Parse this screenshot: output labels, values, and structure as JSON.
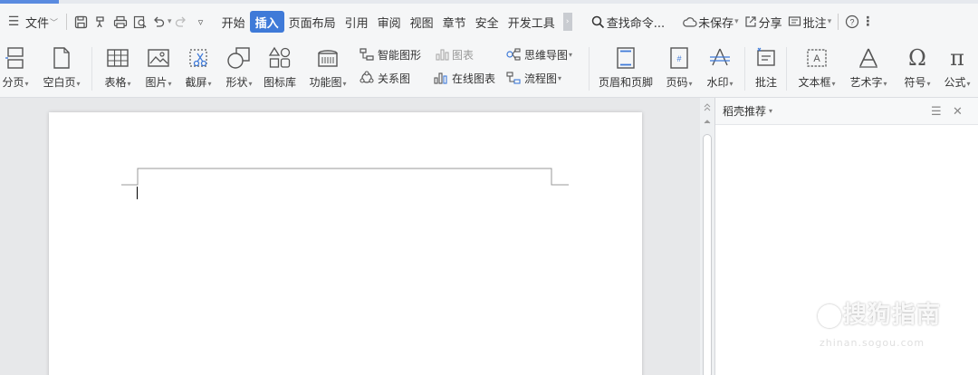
{
  "menubar": {
    "file_label": "文件",
    "tabs": [
      {
        "label": "开始"
      },
      {
        "label": "插入",
        "active": true
      },
      {
        "label": "页面布局"
      },
      {
        "label": "引用"
      },
      {
        "label": "审阅"
      },
      {
        "label": "视图"
      },
      {
        "label": "章节"
      },
      {
        "label": "安全"
      },
      {
        "label": "开发工具"
      }
    ],
    "search_placeholder": "查找命令...",
    "unsaved_label": "未保存",
    "share_label": "分享",
    "comment_label": "批注",
    "accent_color": "#3f7ad8"
  },
  "ribbon": {
    "page_break_label": "分页",
    "blank_page_label": "空白页",
    "table_label": "表格",
    "picture_label": "图片",
    "screenshot_label": "截屏",
    "shape_label": "形状",
    "icon_lib_label": "图标库",
    "func_chart_label": "功能图",
    "smart_art_label": "智能图形",
    "chart_label": "图表",
    "relation_label": "关系图",
    "online_chart_label": "在线图表",
    "mindmap_label": "思维导图",
    "flowchart_label": "流程图",
    "header_footer_label": "页眉和页脚",
    "page_num_label": "页码",
    "watermark_label": "水印",
    "comment_label": "批注",
    "textbox_label": "文本框",
    "wordart_label": "艺术字",
    "symbol_label": "符号",
    "formula_label": "公式"
  },
  "sidepanel": {
    "title": "稻壳推荐"
  },
  "watermark": {
    "brand": "搜狗指南",
    "url": "zhinan.sogou.com"
  }
}
